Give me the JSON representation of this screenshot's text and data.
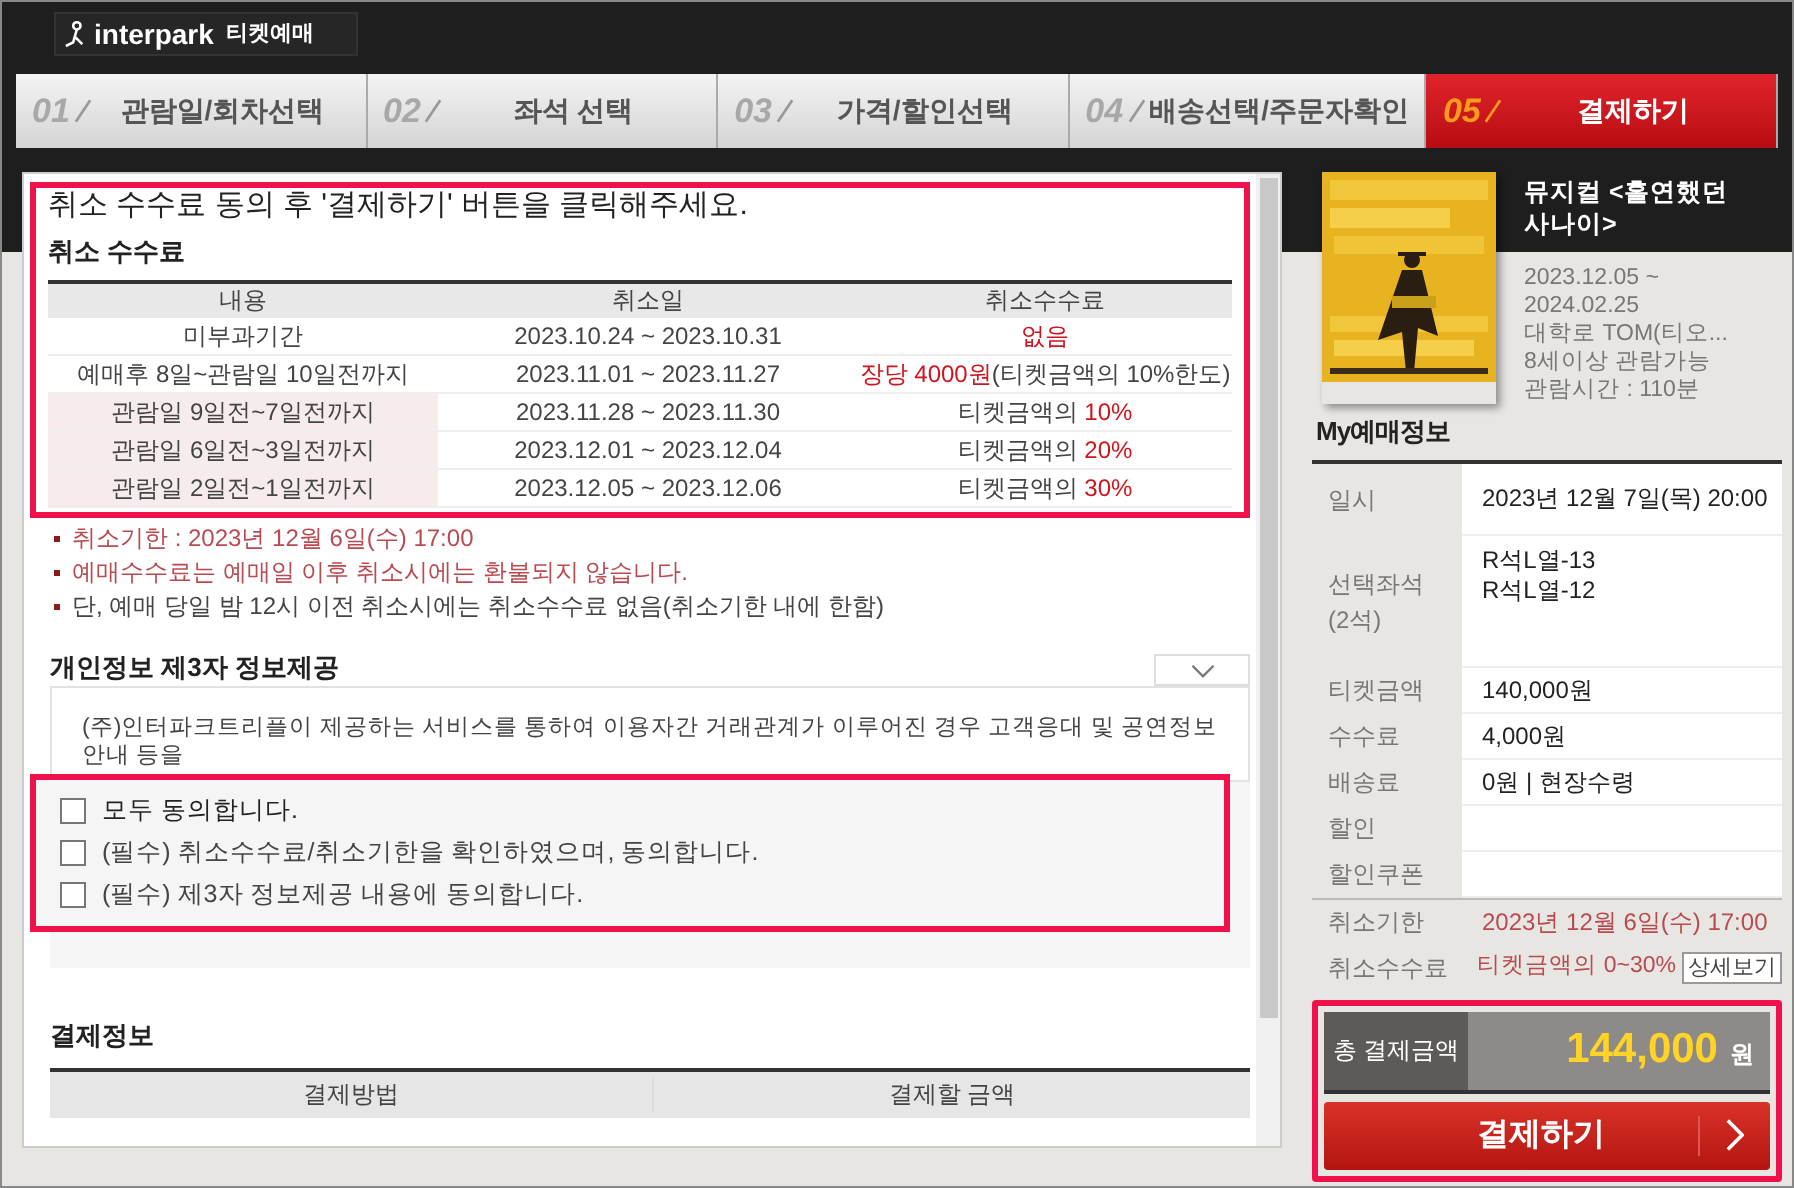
{
  "header": {
    "logo": "interpark",
    "service": "티켓예매"
  },
  "steps": [
    {
      "number": "01",
      "label": "관람일/회차선택",
      "selected": false
    },
    {
      "number": "02",
      "label": "좌석 선택",
      "selected": false
    },
    {
      "number": "03",
      "label": "가격/할인선택",
      "selected": false
    },
    {
      "number": "04",
      "label": "배송선택/주문자확인",
      "selected": false
    },
    {
      "number": "05",
      "label": "결제하기",
      "selected": true
    }
  ],
  "notice": "취소 수수료 동의 후 '결제하기' 버튼을 클릭해주세요.",
  "cancel_fee": {
    "title": "취소 수수료",
    "columns": [
      "내용",
      "취소일",
      "취소수수료"
    ],
    "rows": [
      {
        "period": "미부과기간",
        "dates": "2023.10.24 ~ 2023.10.31",
        "highlighted": false,
        "fee": [
          {
            "text": "없음",
            "emphasis": true
          }
        ]
      },
      {
        "period": "예매후 8일~관람일 10일전까지",
        "dates": "2023.11.01 ~ 2023.11.27",
        "highlighted": false,
        "fee": [
          {
            "text": "장당 4000원",
            "emphasis": true
          },
          {
            "text": "(티켓금액의 10%한도)",
            "emphasis": false
          }
        ]
      },
      {
        "period": "관람일 9일전~7일전까지",
        "dates": "2023.11.28 ~ 2023.11.30",
        "highlighted": true,
        "fee": [
          {
            "text": "티켓금액의 ",
            "emphasis": false
          },
          {
            "text": "10%",
            "emphasis": true
          }
        ]
      },
      {
        "period": "관람일 6일전~3일전까지",
        "dates": "2023.12.01 ~ 2023.12.04",
        "highlighted": true,
        "fee": [
          {
            "text": "티켓금액의 ",
            "emphasis": false
          },
          {
            "text": "20%",
            "emphasis": true
          }
        ]
      },
      {
        "period": "관람일 2일전~1일전까지",
        "dates": "2023.12.05 ~ 2023.12.06",
        "highlighted": true,
        "fee": [
          {
            "text": "티켓금액의 ",
            "emphasis": false
          },
          {
            "text": "30%",
            "emphasis": true
          }
        ]
      }
    ]
  },
  "notes": [
    {
      "text": "취소기한 : 2023년 12월 6일(수) 17:00",
      "emphasis": true
    },
    {
      "text": "예매수수료는 예매일 이후 취소시에는 환불되지 않습니다.",
      "emphasis": true
    },
    {
      "text": "단, 예매 당일 밤 12시 이전 취소시에는 취소수수료 없음(취소기한 내에 한함)",
      "emphasis": false
    }
  ],
  "privacy": {
    "title": "개인정보 제3자 정보제공",
    "paragraphs": [
      "(주)인터파크트리플이 제공하는 서비스를 통하여 이용자간 거래관계가 이루어진 경우 고객응대 및 공연정보 안내 등을"
    ]
  },
  "agreements": [
    {
      "label": "모두 동의합니다.",
      "checked": false,
      "kind": "all"
    },
    {
      "label": "(필수) 취소수수료/취소기한을 확인하였으며, 동의합니다.",
      "checked": false,
      "kind": "item"
    },
    {
      "label": "(필수) 제3자 정보제공 내용에 동의합니다.",
      "checked": false,
      "kind": "item"
    }
  ],
  "payment": {
    "title": "결제정보",
    "columns": [
      "결제방법",
      "결제할 금액"
    ]
  },
  "show": {
    "title": "뮤지컬 <홀연했던 사나이>",
    "info": [
      "2023.12.05 ~ 2024.02.25",
      "대학로 TOM(티오...",
      "8세이상 관람가능",
      "관람시간 : 110분"
    ]
  },
  "my_booking": {
    "title": "My예매정보",
    "rows": [
      {
        "label": "일시",
        "kind": "text",
        "value": "2023년 12월 7일(목) 20:00"
      },
      {
        "label": "선택좌석 (2석)",
        "kind": "lines",
        "lines": [
          "R석L열-13",
          "R석L열-12"
        ]
      },
      {
        "label": "티켓금액",
        "kind": "text",
        "value": "140,000원"
      },
      {
        "label": "수수료",
        "kind": "text",
        "value": "4,000원"
      },
      {
        "label": "배송료",
        "kind": "text",
        "value": "0원 | 현장수령"
      },
      {
        "label": "할인",
        "kind": "empty"
      },
      {
        "label": "할인쿠폰",
        "kind": "empty"
      },
      {
        "label": "취소기한",
        "kind": "alert",
        "value": "2023년 12월 6일(수) 17:00"
      },
      {
        "label": "취소수수료",
        "kind": "detail",
        "value": "티켓금액의 0~30%",
        "button": "상세보기"
      }
    ]
  },
  "total": {
    "label": "총 결제금액",
    "amount": "144,000",
    "unit": "원"
  },
  "pay_button": "결제하기"
}
